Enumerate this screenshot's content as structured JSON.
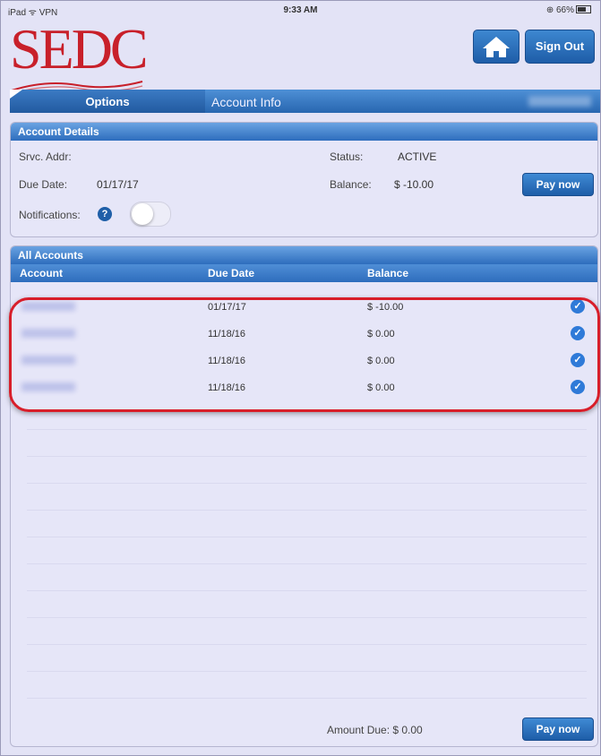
{
  "status_bar": {
    "left": "iPad ᯤ VPN",
    "time": "9:33 AM",
    "battery": "⊕ 66%"
  },
  "header": {
    "logo_text": "SEDC",
    "home_icon": "home-icon",
    "sign_out_label": "Sign Out"
  },
  "tabs": {
    "options_label": "Options",
    "account_info_label": "Account Info"
  },
  "account_details": {
    "title": "Account Details",
    "srvc_addr_label": "Srvc. Addr:",
    "srvc_addr_value": "",
    "status_label": "Status:",
    "status_value": "ACTIVE",
    "due_date_label": "Due Date:",
    "due_date_value": "01/17/17",
    "balance_label": "Balance:",
    "balance_value": "$ -10.00",
    "pay_now_label": "Pay now",
    "notifications_label": "Notifications:",
    "help_icon": "help-icon",
    "notifications_on": false
  },
  "all_accounts": {
    "title": "All Accounts",
    "columns": [
      "Account",
      "Due Date",
      "Balance"
    ],
    "rows": [
      {
        "account": "",
        "due_date": "01/17/17",
        "balance": "$ -10.00",
        "selected": true
      },
      {
        "account": "",
        "due_date": "11/18/16",
        "balance": "$ 0.00",
        "selected": true
      },
      {
        "account": "",
        "due_date": "11/18/16",
        "balance": "$ 0.00",
        "selected": true
      },
      {
        "account": "",
        "due_date": "11/18/16",
        "balance": "$ 0.00",
        "selected": true
      }
    ],
    "amount_due_label": "Amount Due: $ 0.00",
    "pay_now_label": "Pay now"
  },
  "colors": {
    "accent": "#2d6dbd",
    "logo_red": "#c8202a",
    "highlight_red": "#d81e2a",
    "background": "#e3e3f6"
  }
}
